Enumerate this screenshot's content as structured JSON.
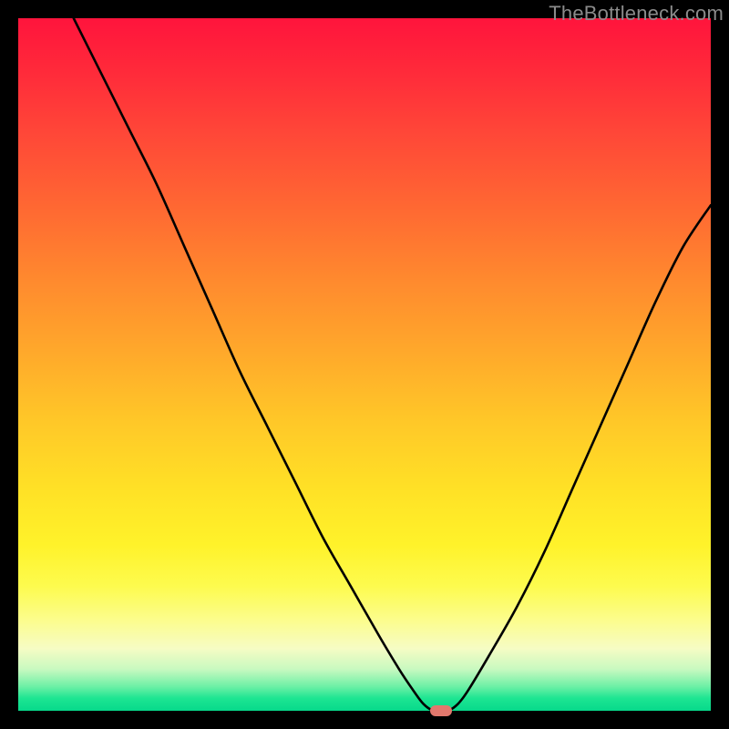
{
  "watermark": "TheBottleneck.com",
  "chart_data": {
    "type": "line",
    "title": "",
    "xlabel": "",
    "ylabel": "",
    "xlim": [
      0,
      100
    ],
    "ylim": [
      0,
      100
    ],
    "grid": false,
    "series": [
      {
        "name": "bottleneck-curve",
        "color": "#000000",
        "x": [
          8,
          12,
          16,
          20,
          24,
          28,
          32,
          36,
          40,
          44,
          48,
          52,
          55,
          57,
          58.5,
          60,
          62,
          63.5,
          65,
          68,
          72,
          76,
          80,
          84,
          88,
          92,
          96,
          100
        ],
        "y": [
          100,
          92,
          84,
          76,
          67,
          58,
          49,
          41,
          33,
          25,
          18,
          11,
          6,
          3,
          1,
          0,
          0,
          1,
          3,
          8,
          15,
          23,
          32,
          41,
          50,
          59,
          67,
          73
        ]
      }
    ],
    "marker": {
      "name": "optimal-point",
      "x": 61,
      "y": 0,
      "color": "#e2786d"
    },
    "background_gradient": {
      "top": "#ff143c",
      "middle": "#ffe126",
      "bottom": "#07d98b"
    }
  }
}
